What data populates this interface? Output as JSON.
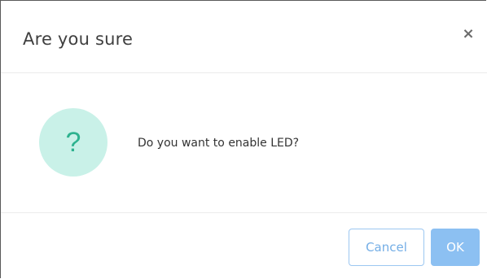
{
  "dialog": {
    "title": "Are you sure",
    "close_label": "×",
    "icon_glyph": "?",
    "icon_name": "question-icon",
    "message": "Do you want to enable LED?",
    "cancel_label": "Cancel",
    "ok_label": "OK"
  },
  "colors": {
    "icon_bg": "#c9f1e8",
    "icon_fg": "#2db28f",
    "primary": "#8cc0f2",
    "secondary_border": "#9cc7f1"
  }
}
